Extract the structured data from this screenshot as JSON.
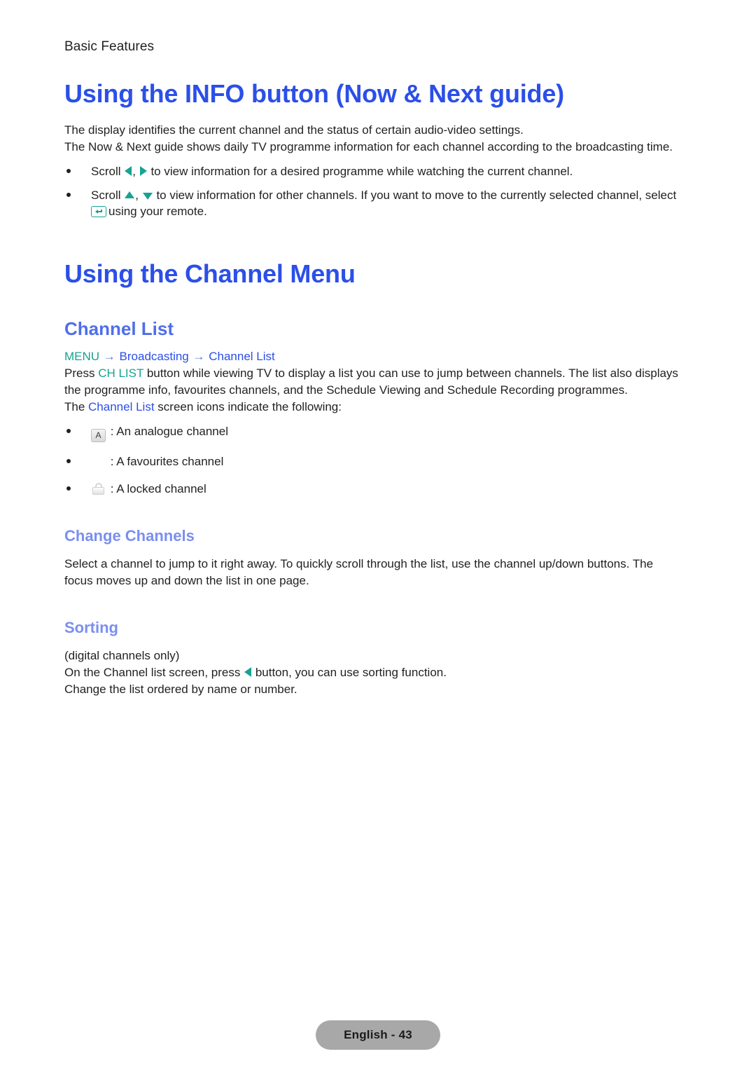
{
  "header": {
    "running_head": "Basic Features"
  },
  "sections": {
    "info_button": {
      "title": "Using the INFO button (Now & Next guide)",
      "paragraphs": [
        "The display identifies the current channel and the status of certain audio-video settings.",
        "The Now & Next guide shows daily TV programme information for each channel according to the broadcasting time."
      ],
      "bullets": [
        {
          "prefix": "Scroll",
          "icons": [
            "arrow-left-icon",
            "arrow-right-icon"
          ],
          "separator": ",",
          "text": "to view information for a desired programme while watching the current channel."
        },
        {
          "prefix": "Scroll",
          "icons": [
            "arrow-up-icon",
            "arrow-down-icon"
          ],
          "separator": ",",
          "text": "to view information for other channels. If you want to move to the currently selected channel, select",
          "second_line_icon": "enter-key-icon",
          "second_line_text": "using your remote."
        }
      ]
    },
    "channel_menu": {
      "title": "Using the Channel Menu",
      "channel_list": {
        "heading": "Channel List",
        "menu_path": {
          "step1": "MENU",
          "arrow1": "→",
          "step2": "Broadcasting",
          "arrow2": "→",
          "step3": "Channel List"
        },
        "press_prefix": "Press",
        "press_key": "CH LIST",
        "press_rest": "button while viewing TV to display a list you can use to jump between channels. The list also displays",
        "paragraph2": "the programme info, favourites channels, and the Schedule Viewing and Schedule Recording programmes.",
        "icons_intro_prefix": "The",
        "icons_intro_link": "Channel List",
        "icons_intro_suffix": "screen icons indicate the following:",
        "icon_items": [
          {
            "icon": "analogue-channel-icon",
            "icon_glyph": "A",
            "label": ": An analogue channel"
          },
          {
            "icon": "favourite-channel-icon",
            "icon_glyph": "",
            "label": ": A favourites channel"
          },
          {
            "icon": "locked-channel-icon",
            "icon_glyph": "",
            "label": ": A locked channel"
          }
        ]
      },
      "change_channels": {
        "heading": "Change Channels",
        "paragraphs": [
          "Select a channel to jump to it right away. To quickly scroll through the list, use the channel up/down buttons. The",
          "focus moves up and down the list in one page."
        ]
      },
      "sorting": {
        "heading": "Sorting",
        "note": "(digital channels only)",
        "line_prefix": "On the Channel list screen, press",
        "line_icon": "arrow-left-icon",
        "line_suffix": "button, you can use sorting function.",
        "line2": "Change the list ordered by name or number."
      }
    }
  },
  "footer": {
    "page_label": "English - 43"
  },
  "colors": {
    "heading_blue": "#2b4fe8",
    "subheading_blue": "#4f6ee9",
    "subsub_blue": "#7b8ef0",
    "accent_teal": "#17a294",
    "body_text": "#231f20",
    "footer_pill": "#a8a8a8"
  }
}
